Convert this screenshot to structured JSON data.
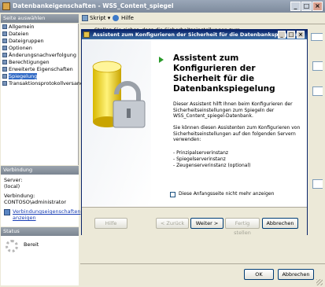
{
  "window": {
    "title": "Datenbankeigenschaften - WSS_Content_spiegel"
  },
  "left": {
    "select_page_header": "Seite auswählen",
    "nav_items": [
      {
        "label": "Allgemein"
      },
      {
        "label": "Dateien"
      },
      {
        "label": "Dateigruppen"
      },
      {
        "label": "Optionen"
      },
      {
        "label": "Änderungsnachverfolgung"
      },
      {
        "label": "Berechtigungen"
      },
      {
        "label": "Erweiterte Eigenschaften"
      },
      {
        "label": "Spiegelung"
      },
      {
        "label": "Transaktionsprotokollversand"
      }
    ],
    "connection_header": "Verbindung",
    "server_label": "Server:",
    "server_value": "(local)",
    "connection_label": "Verbindung:",
    "connection_value": "CONTOSO\\administrator",
    "conn_props_link": "Verbindungseigenschaften anzeigen",
    "status_header": "Status",
    "status_value": "Bereit"
  },
  "toolbar": {
    "script_label": "Skript",
    "help_label": "Hilfe"
  },
  "main": {
    "intro_text": "Stellen Sie sicher, dass die Sicherheitseinstellungen zum"
  },
  "wizard": {
    "title": "Assistent zum Konfigurieren der Sicherheit für die Datenbankspiegelung",
    "heading": "Assistent zum Konfigurieren der Sicherheit für die Datenbankspiegelung",
    "para1": "Dieser Assistent hilft Ihnen beim Konfigurieren der Sicherheitseinstellungen zum Spiegeln der WSS_Content_spiegel-Datenbank.",
    "para2": "Sie können diesen Assistenten zum Konfigurieren von Sicherheitseinstellungen auf den folgenden Servern verwenden:",
    "servers": [
      "- Prinzipalserverinstanz",
      "- Spiegelserverinstanz",
      "- Zeugenserverinstanz (optional)"
    ],
    "checkbox_label": "Diese Anfangsseite nicht mehr anzeigen",
    "btn_help": "Hilfe",
    "btn_back": "< Zurück",
    "btn_next": "Weiter >",
    "btn_finish": "Fertig stellen",
    "btn_cancel": "Abbrechen"
  },
  "footer": {
    "ok_label": "OK",
    "cancel_label": "Abbrechen"
  }
}
